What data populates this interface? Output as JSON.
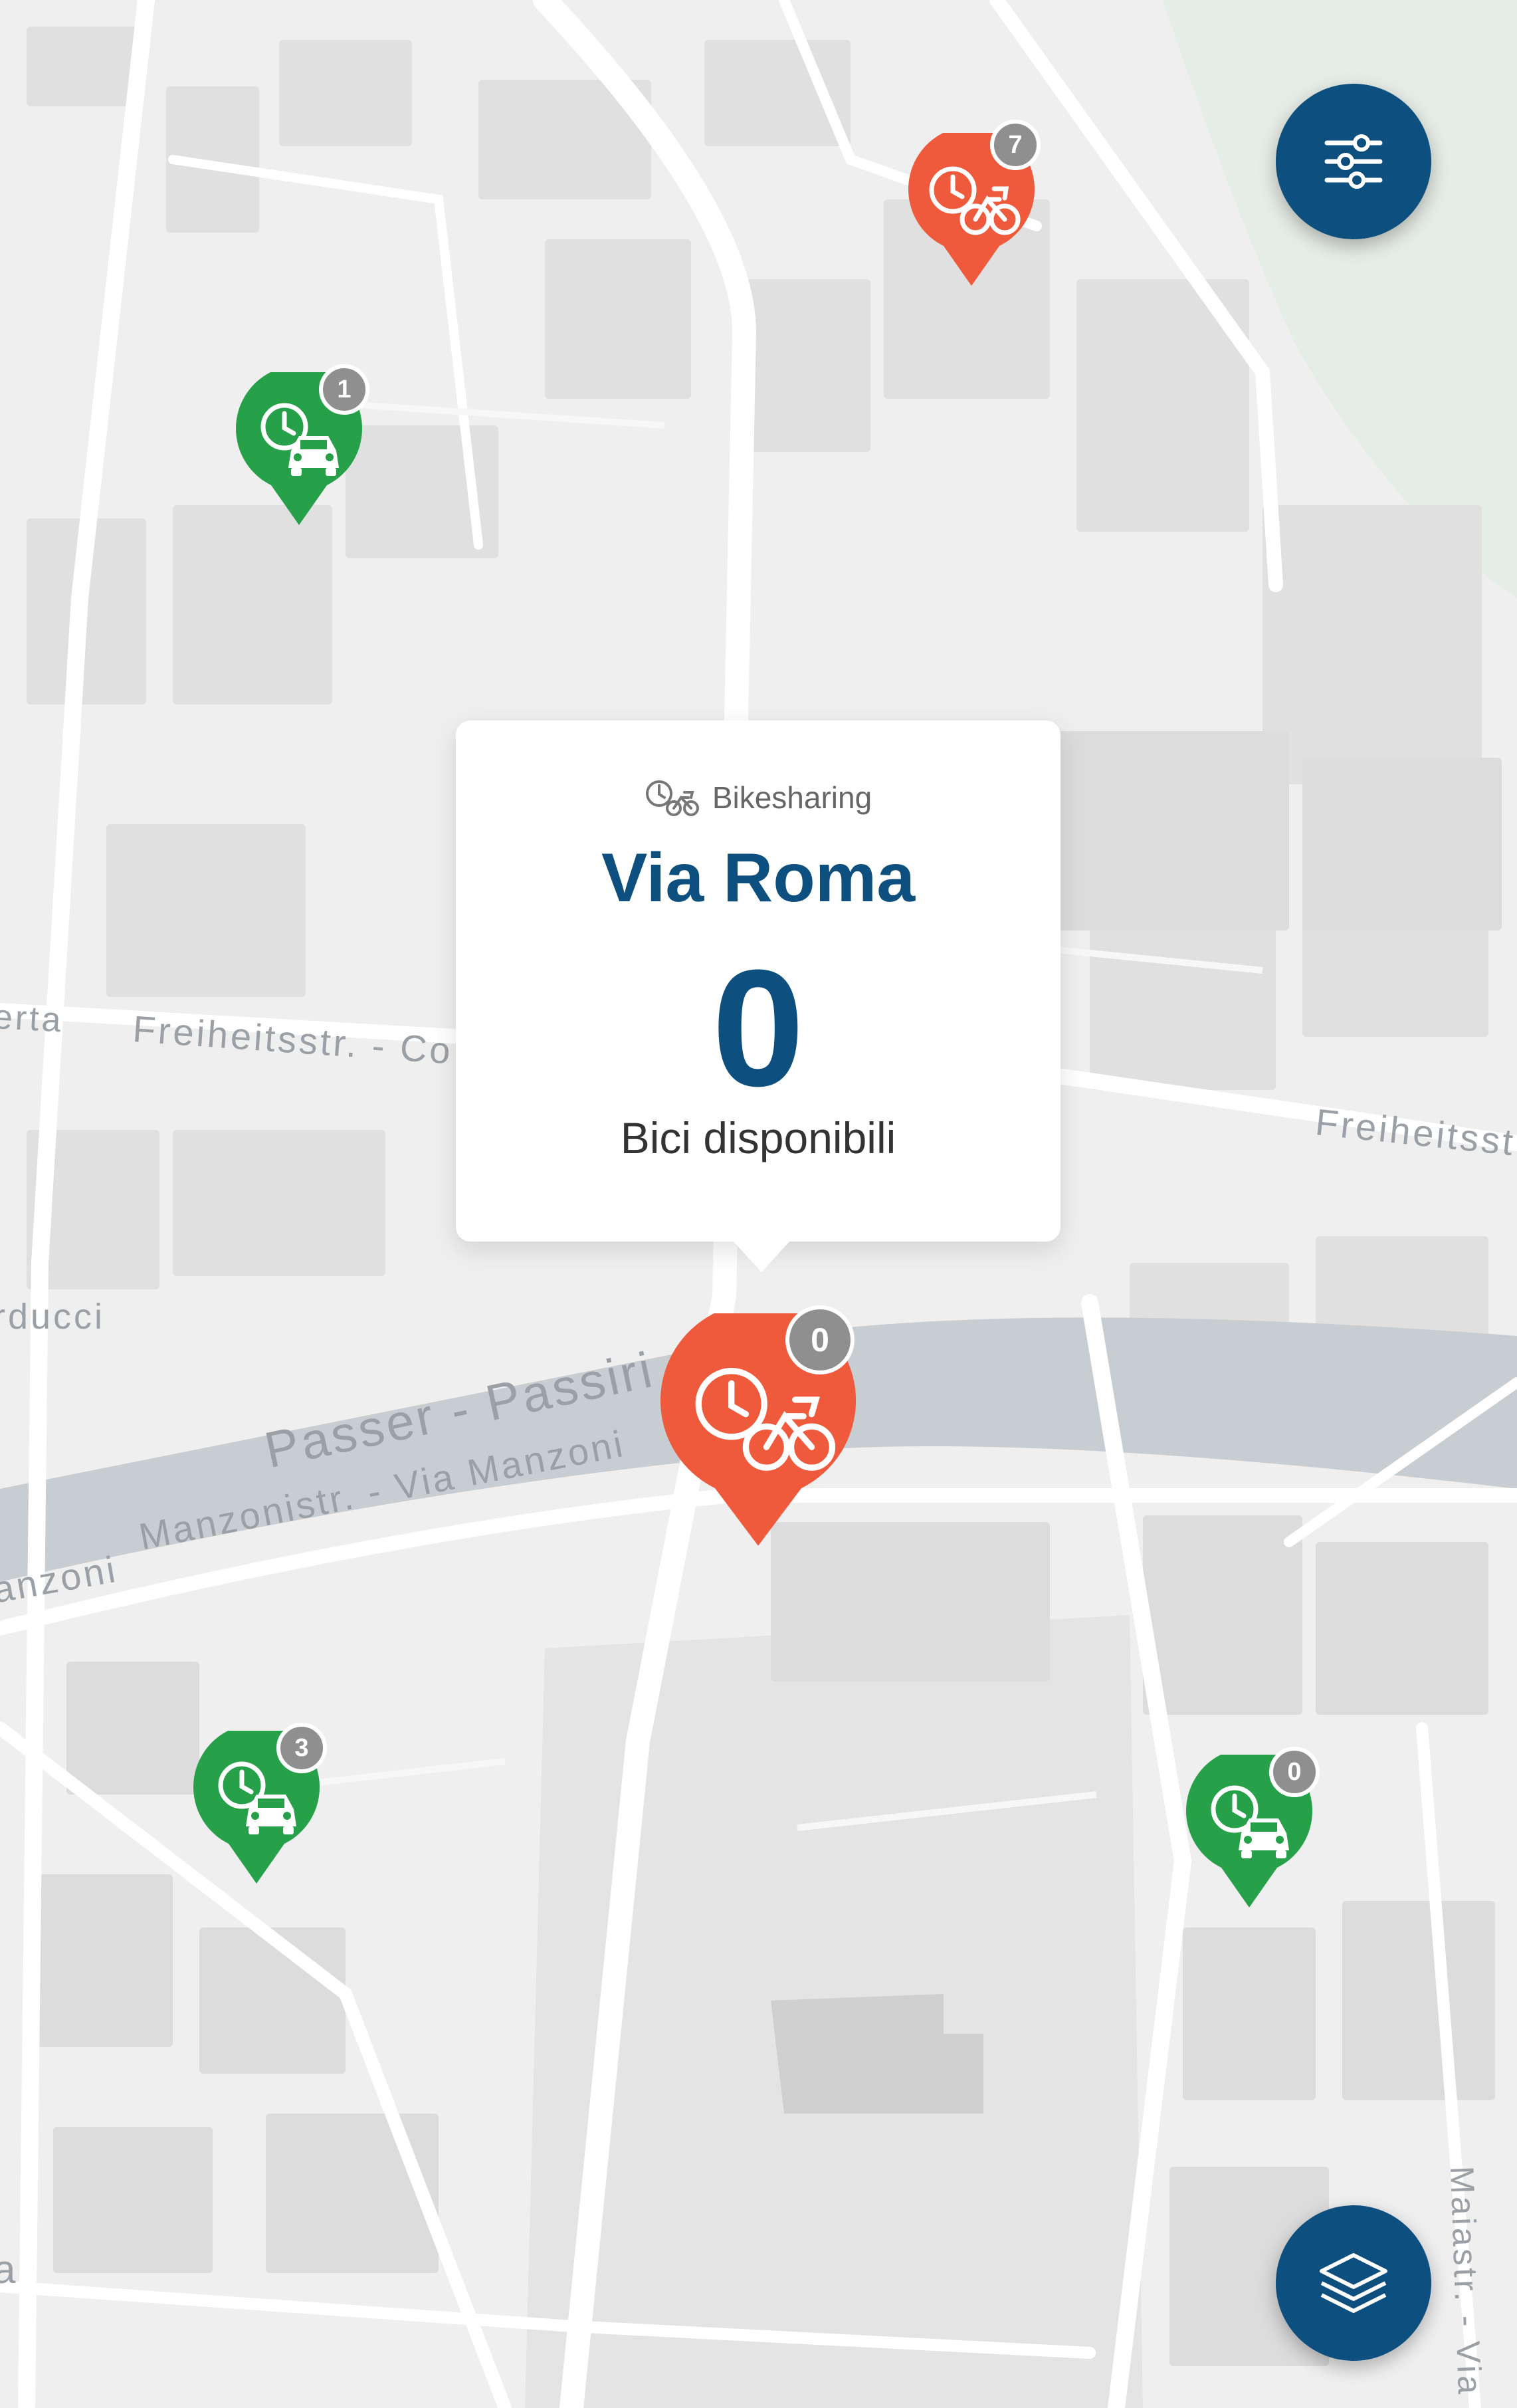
{
  "map": {
    "street_labels": [
      "erta",
      "Freiheitsstr. - Co",
      "Freiheitsst",
      "rducci",
      "Passer - Passiri",
      "Manzonistr. - Via Manzoni",
      "anzoni",
      "Maiastr. - Via",
      "a"
    ]
  },
  "controls": {
    "filter_icon": "sliders-icon",
    "layers_icon": "layers-icon",
    "accent_color": "#0d4f7e"
  },
  "markers": [
    {
      "kind": "bikesharing",
      "icon": "clock-bike-icon",
      "color": "#f05a3c",
      "count": "7"
    },
    {
      "kind": "carsharing",
      "icon": "clock-car-icon",
      "color": "#27a04a",
      "count": "1"
    },
    {
      "kind": "bikesharing",
      "icon": "clock-bike-icon",
      "color": "#f05a3c",
      "count": "0"
    },
    {
      "kind": "carsharing",
      "icon": "clock-car-icon",
      "color": "#27a04a",
      "count": "3"
    },
    {
      "kind": "carsharing",
      "icon": "clock-car-icon",
      "color": "#27a04a",
      "count": "0"
    }
  ],
  "popup": {
    "category": "Bikesharing",
    "title": "Via Roma",
    "count": "0",
    "caption": "Bici disponibili"
  }
}
